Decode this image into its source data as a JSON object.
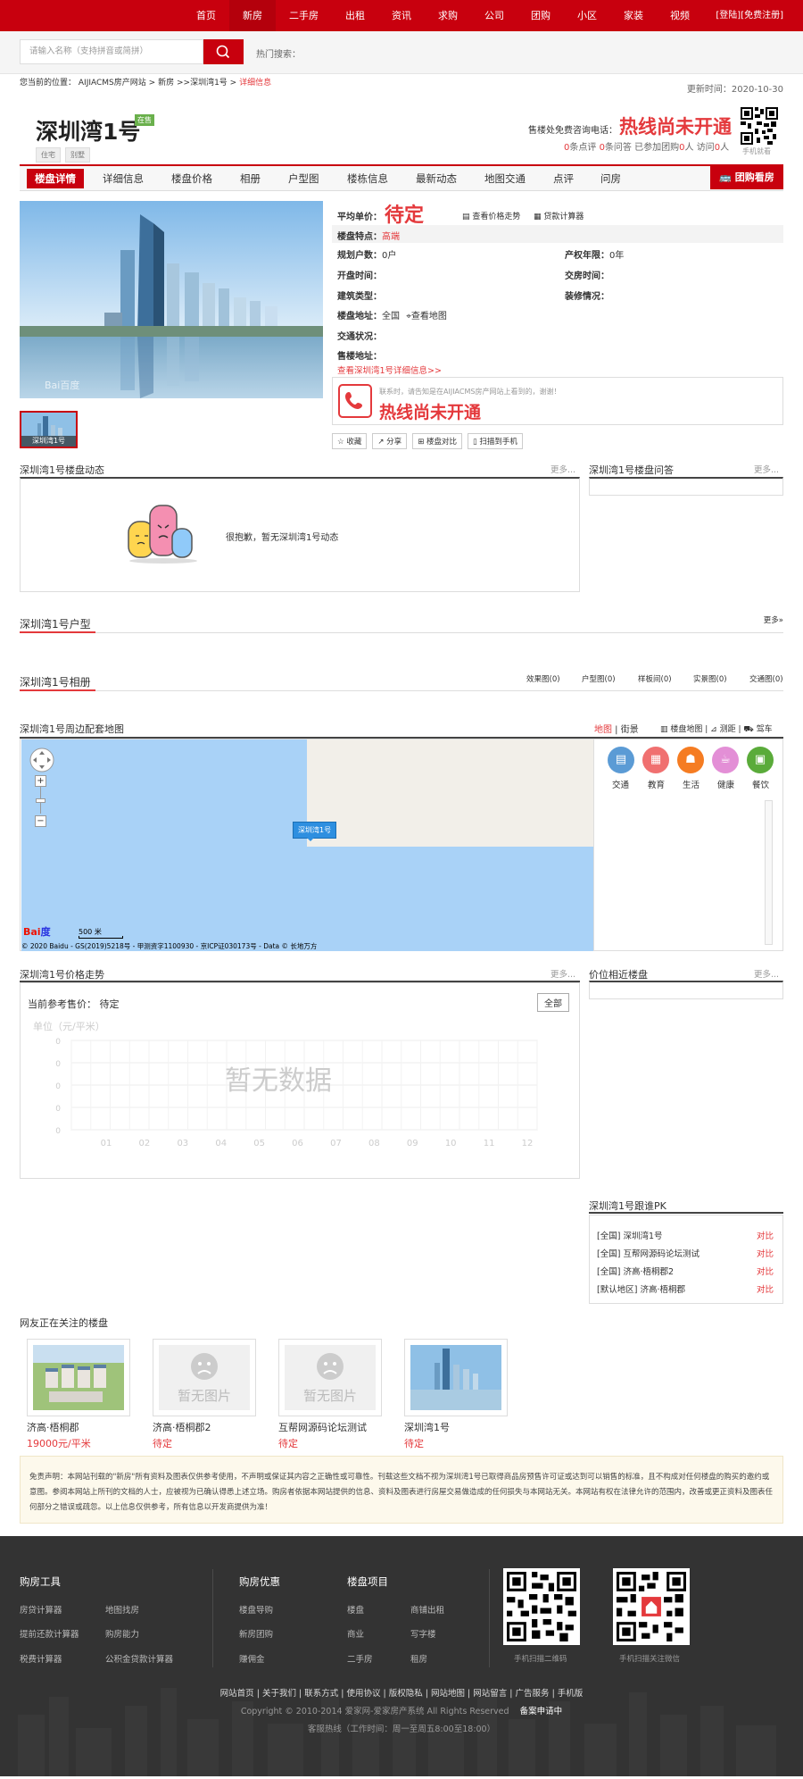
{
  "topnav": {
    "items": [
      "首页",
      "新房",
      "二手房",
      "出租",
      "资讯",
      "求购",
      "公司",
      "团购",
      "小区",
      "家装",
      "视频"
    ],
    "active": 1,
    "login": "[登陆]",
    "register": "[免费注册]"
  },
  "search": {
    "placeholder": "请输入名称（支持拼音或简拼）",
    "hot_label": "热门搜索："
  },
  "breadcrumb": {
    "prefix": "您当前的位置：",
    "site": "AIJIACMS房产网站",
    "sep1": ">",
    "newhouse": "新房",
    "sep2": ">>",
    "project": "深圳湾1号",
    "sep3": ">",
    "current": "详细信息"
  },
  "update_time": "更新时间：2020-10-30",
  "project": {
    "title": "深圳湾1号",
    "status_badge": "在售",
    "tags": [
      "住宅",
      "别墅"
    ],
    "phone_label": "售楼处免费咨询电话：",
    "phone": "热线尚未开通",
    "stats": {
      "reviews": "0",
      "reviews_label": "条点评",
      "questions": "0",
      "questions_label": "条问答",
      "groupbuy_prefix": "已参加团购",
      "groupbuy": "0",
      "groupbuy_suffix": "人",
      "visits_prefix": "访问",
      "visits": "0",
      "visits_suffix": "人"
    },
    "qr_label": "手机就看"
  },
  "tabs": [
    "楼盘详情",
    "详细信息",
    "楼盘价格",
    "相册",
    "户型图",
    "楼栋信息",
    "最新动态",
    "地图交通",
    "点评",
    "问房"
  ],
  "tuangou": "团购看房",
  "thumb_label": "深圳湾1号",
  "info": {
    "avg_price_label": "平均单价：",
    "avg_price": "待定",
    "price_trend": "查看价格走势",
    "loan_calc": "贷款计算器",
    "feature_label": "楼盘特点：",
    "feature": "高端",
    "households_label": "规划户数：",
    "households": "0户",
    "property_years_label": "产权年限：",
    "property_years": "0年",
    "open_label": "开盘时间：",
    "handover_label": "交房时间：",
    "build_type_label": "建筑类型：",
    "decoration_label": "装修情况：",
    "address_label": "楼盘地址：",
    "address": "全国",
    "view_map": "查看地图",
    "traffic_label": "交通状况：",
    "sales_addr_label": "售楼地址：",
    "more_link": "查看深圳湾1号详细信息>>",
    "hotline_note": "联系时，请告知是在AIJIACMS房产网站上看到的，谢谢！",
    "hotline": "热线尚未开通"
  },
  "actions": [
    "收藏",
    "分享",
    "楼盘对比",
    "扫描到手机"
  ],
  "dynamics": {
    "title": "深圳湾1号楼盘动态",
    "more": "更多...",
    "empty": "很抱歉，暂无深圳湾1号动态"
  },
  "qa": {
    "title": "深圳湾1号楼盘问答",
    "more": "更多..."
  },
  "huxing": {
    "title": "深圳湾1号户型",
    "more": "更多»"
  },
  "album": {
    "title": "深圳湾1号相册",
    "cats": [
      "效果图(0)",
      "户型图(0)",
      "样板间(0)",
      "实景图(0)",
      "交通图(0)"
    ]
  },
  "map": {
    "title": "深圳湾1号周边配套地图",
    "modes": [
      "地图",
      "街景"
    ],
    "tools": [
      "楼盘地图",
      "测距",
      "驾车"
    ],
    "marker": "深圳湾1号",
    "scale": "500 米",
    "copyright": "© 2020 Baidu - GS(2019)5218号 - 甲测资字1100930 - 京ICP证030173号 - Data © 长地万方",
    "poi": [
      "交通",
      "教育",
      "生活",
      "健康",
      "餐饮"
    ],
    "poi_colors": [
      "#5b9bd5",
      "#f07070",
      "#f57c22",
      "#e38fd6",
      "#5aab3a"
    ]
  },
  "price_trend": {
    "title": "深圳湾1号价格走势",
    "more": "更多...",
    "current_label": "当前参考售价：",
    "current": "待定",
    "all_btn": "全部"
  },
  "chart_data": {
    "type": "line",
    "title": "",
    "ylabel": "单位（元/平米）",
    "categories": [
      "01",
      "02",
      "03",
      "04",
      "05",
      "06",
      "07",
      "08",
      "09",
      "10",
      "11",
      "12"
    ],
    "series": [],
    "y_ticks": [
      "0",
      "0",
      "0",
      "0",
      "0"
    ],
    "empty_text": "暂无数据",
    "grid": true
  },
  "nearby": {
    "title": "价位相近楼盘",
    "more": "更多..."
  },
  "pk": {
    "title": "深圳湾1号跟谁PK",
    "rows": [
      {
        "region": "[全国]",
        "name": "深圳湾1号",
        "action": "对比"
      },
      {
        "region": "[全国]",
        "name": "互帮网源码论坛测试",
        "action": "对比"
      },
      {
        "region": "[全国]",
        "name": "济高·梧桐郡2",
        "action": "对比"
      },
      {
        "region": "[默认地区]",
        "name": "济高·梧桐郡",
        "action": "对比"
      }
    ]
  },
  "related": {
    "title": "网友正在关注的楼盘",
    "items": [
      {
        "name": "济高·梧桐郡",
        "price": "19000元/平米",
        "img": "photo-aerial"
      },
      {
        "name": "济高·梧桐郡2",
        "price": "待定",
        "img": "no-image"
      },
      {
        "name": "互帮网源码论坛测试",
        "price": "待定",
        "img": "no-image"
      },
      {
        "name": "深圳湾1号",
        "price": "待定",
        "img": "photo-towers"
      }
    ],
    "no_image": "暂无图片"
  },
  "disclaimer": "免责声明：本网站刊载的\"新房\"所有资料及图表仅供参考使用，不声明或保证其内容之正确性或可靠性。刊载这些文档不视为深圳湾1号已取得商品房预售许可证或达到可以销售的标准，且不构成对任何楼盘的购买的邀约或意图。参阅本网站上所刊的文档的人士，应被视为已确认得悉上述立场。购房者依据本网站提供的信息、资料及图表进行房屋交易做造成的任何损失与本网站无关。本网站有权在法律允许的范围内，改善或更正资料及图表任何部分之错误或疏忽。以上信息仅供参考，所有信息以开发商提供为准！",
  "footer": {
    "col1": {
      "title": "购房工具",
      "items": [
        "房贷计算器",
        "地图找房",
        "提前还款计算器",
        "购房能力",
        "税费计算器",
        "公积金贷款计算器"
      ]
    },
    "col2": {
      "title": "购房优惠",
      "items": [
        "楼盘导购",
        "新房团购",
        "赚佣金"
      ]
    },
    "col3": {
      "title": "楼盘项目",
      "items": [
        "楼盘",
        "商铺出租",
        "商业",
        "写字楼",
        "二手房",
        "租房"
      ]
    },
    "qr1": "手机扫描二维码",
    "qr2": "手机扫描关注微信",
    "links": [
      "网站首页",
      "关于我们",
      "联系方式",
      "使用协议",
      "版权隐私",
      "网站地图",
      "网站留言",
      "广告服务",
      "手机版"
    ],
    "copyright": "Copyright © 2010-2014 爱家网-爱家房产系统 All Rights Reserved",
    "beian": "备案申请中",
    "hotline": "客服热线（工作时间：周一至周五8:00至18:00）"
  }
}
